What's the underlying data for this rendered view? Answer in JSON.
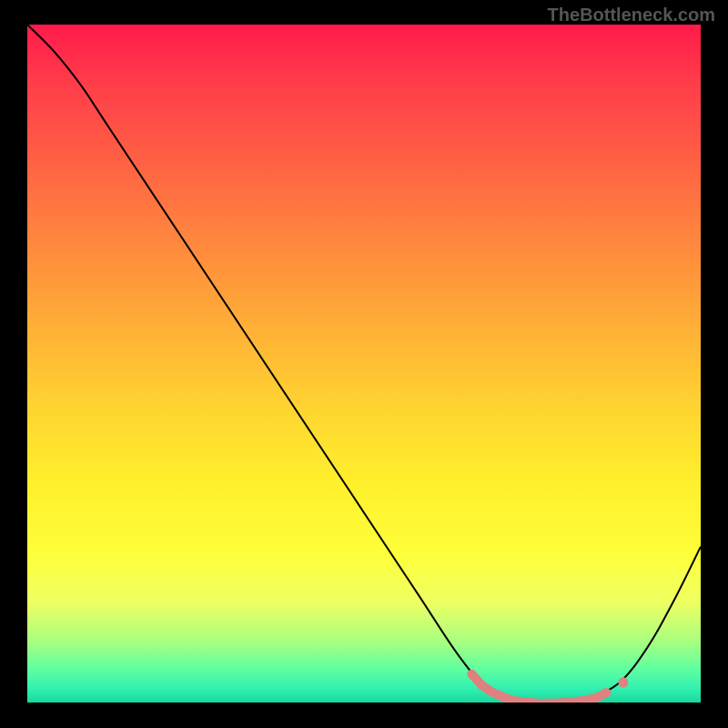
{
  "attribution": "TheBottleneck.com",
  "chart_data": {
    "type": "line",
    "title": "",
    "xlabel": "",
    "ylabel": "",
    "xlim": [
      0,
      100
    ],
    "ylim": [
      0,
      100
    ],
    "curve_points": [
      {
        "x": 0,
        "y": 100
      },
      {
        "x": 4,
        "y": 96
      },
      {
        "x": 8,
        "y": 91
      },
      {
        "x": 12,
        "y": 85
      },
      {
        "x": 20,
        "y": 73
      },
      {
        "x": 30,
        "y": 58
      },
      {
        "x": 40,
        "y": 43
      },
      {
        "x": 50,
        "y": 28
      },
      {
        "x": 58,
        "y": 16
      },
      {
        "x": 64,
        "y": 7
      },
      {
        "x": 68,
        "y": 2.5
      },
      {
        "x": 72,
        "y": 0.8
      },
      {
        "x": 76,
        "y": 0.4
      },
      {
        "x": 80,
        "y": 0.5
      },
      {
        "x": 84,
        "y": 1
      },
      {
        "x": 88,
        "y": 3
      },
      {
        "x": 92,
        "y": 8
      },
      {
        "x": 96,
        "y": 15
      },
      {
        "x": 100,
        "y": 23
      }
    ],
    "optimal_range": {
      "x_start": 66,
      "x_end": 86
    },
    "optimal_outlier_point": {
      "x": 88.5,
      "y": 3.5
    }
  }
}
